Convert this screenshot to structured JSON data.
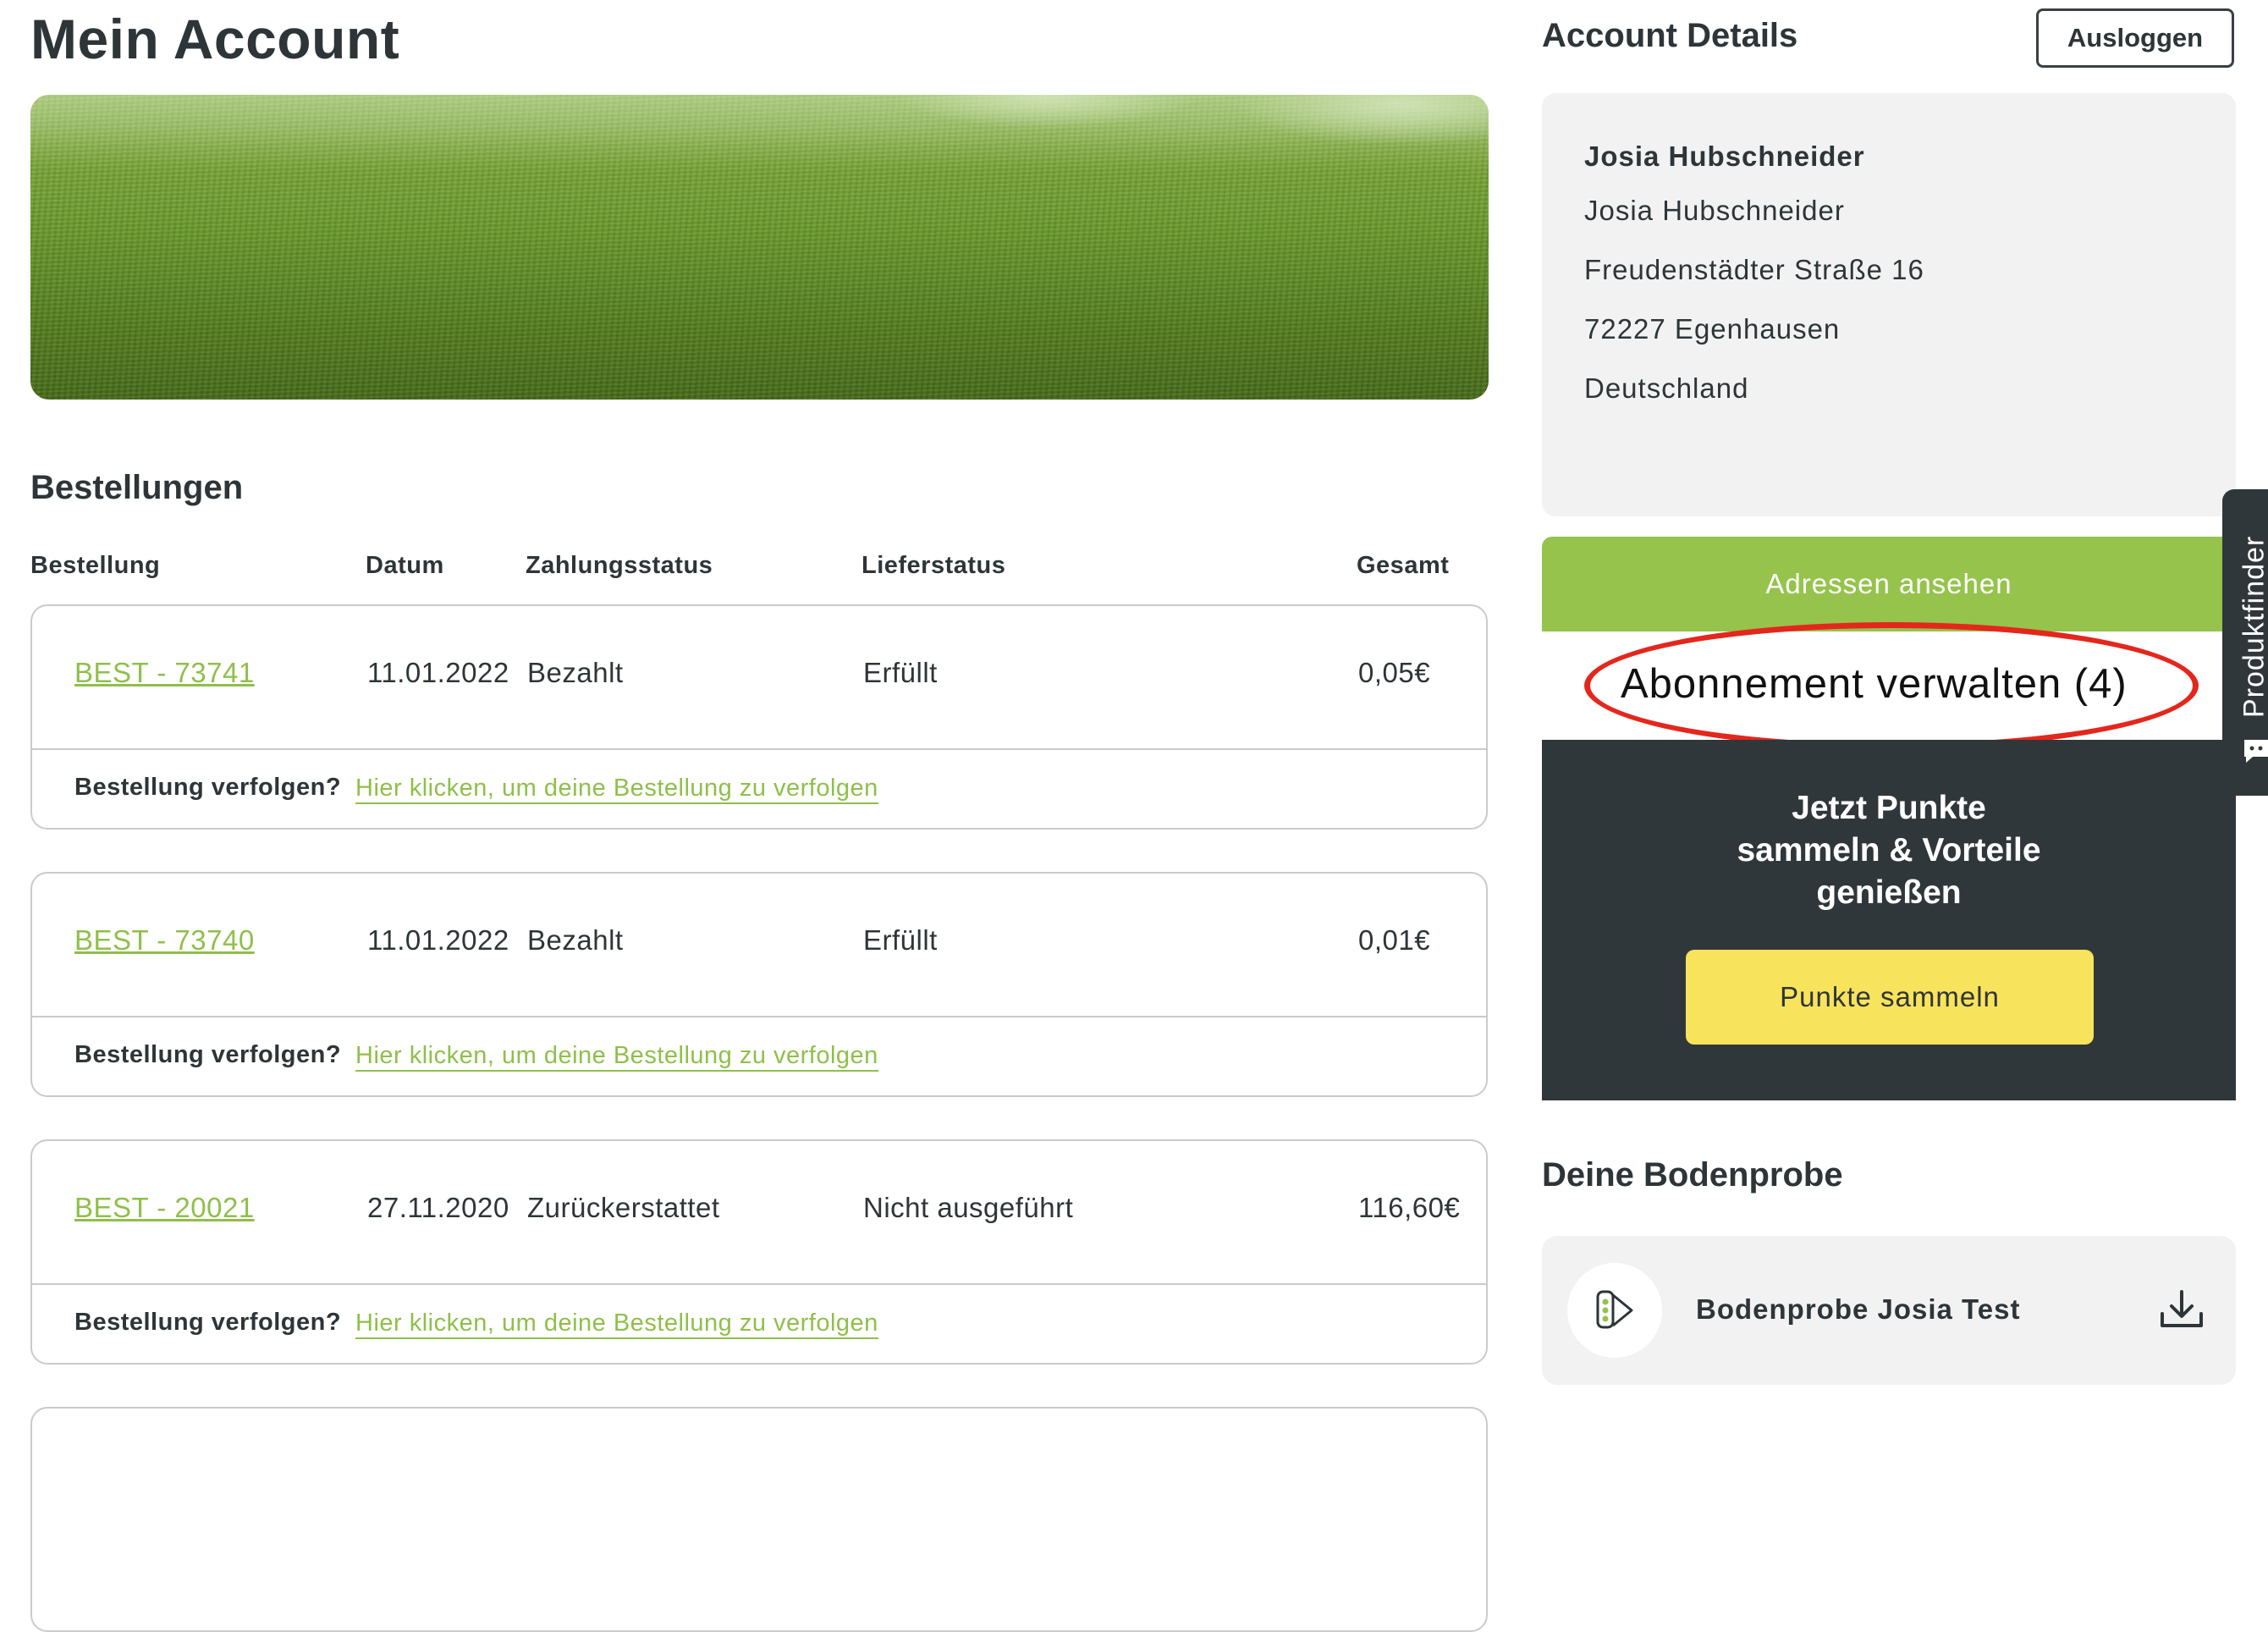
{
  "page_title": "Mein Account",
  "orders_section": {
    "title": "Bestellungen",
    "columns": [
      "Bestellung",
      "Datum",
      "Zahlungsstatus",
      "Lieferstatus",
      "Gesamt"
    ],
    "track_prompt": "Bestellung verfolgen?",
    "track_link": "Hier klicken, um deine Bestellung zu verfolgen",
    "orders": [
      {
        "id": "BEST - 73741",
        "date": "11.01.2022",
        "payment": "Bezahlt",
        "delivery": "Erfüllt",
        "total": "0,05€"
      },
      {
        "id": "BEST - 73740",
        "date": "11.01.2022",
        "payment": "Bezahlt",
        "delivery": "Erfüllt",
        "total": "0,01€"
      },
      {
        "id": "BEST - 20021",
        "date": "27.11.2020",
        "payment": "Zurückerstattet",
        "delivery": "Nicht ausgeführt",
        "total": "116,60€"
      }
    ]
  },
  "account_details": {
    "title": "Account Details",
    "logout_label": "Ausloggen",
    "name_bold": "Josia Hubschneider",
    "address_lines": [
      "Josia Hubschneider",
      "Freudenstädter Straße 16",
      "72227 Egenhausen",
      "Deutschland"
    ],
    "addresses_button": "Adressen ansehen",
    "subscription_link": "Abonnement verwalten (4)"
  },
  "points_promo": {
    "title_lines": [
      "Jetzt Punkte",
      "sammeln & Vorteile",
      "genießen"
    ],
    "button_label": "Punkte sammeln"
  },
  "soil_sample": {
    "title": "Deine Bodenprobe",
    "item_label": "Bodenprobe Josia Test",
    "item_icon": "soil-test-tube-icon",
    "action_icon": "download-icon"
  },
  "side_tab": {
    "label": "Produktfinder",
    "icon": "chat-icon"
  },
  "colors": {
    "accent_green": "#95c34c",
    "link_green": "#8fbf4a",
    "dark_panel": "#30373b",
    "yellow_button": "#f8e35c",
    "highlight_red": "#e4271c"
  }
}
